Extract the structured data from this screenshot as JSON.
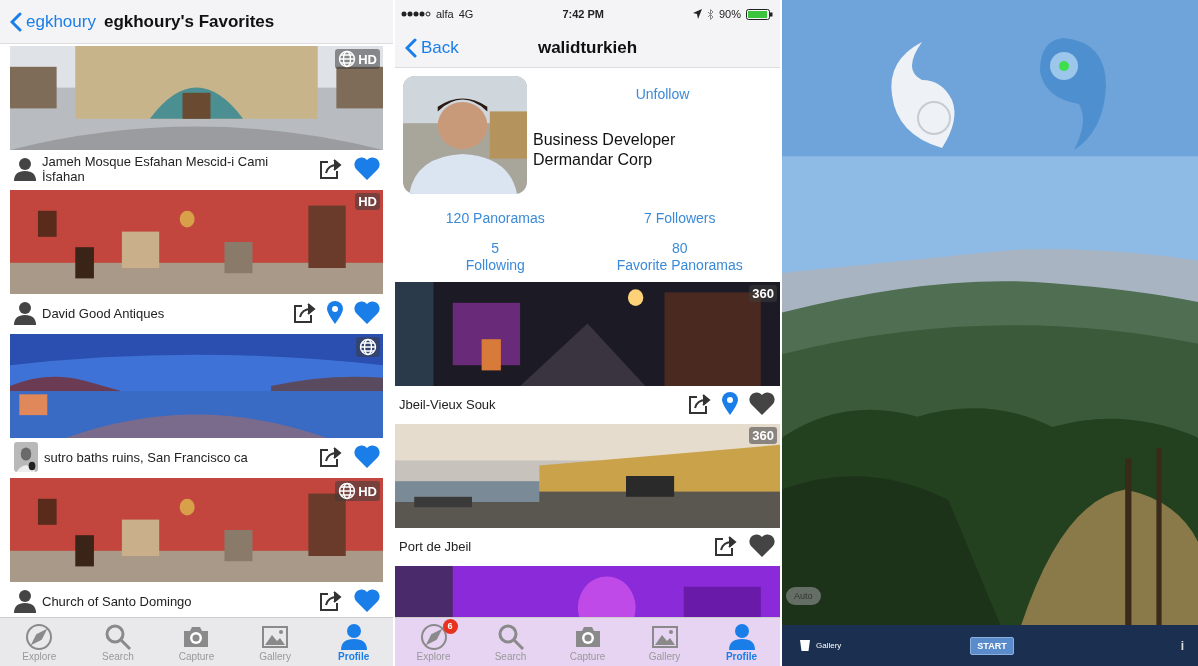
{
  "favorites_screen": {
    "back_label": "egkhoury",
    "title": "egkhoury's Favorites",
    "cards": [
      {
        "title": "Jameh Mosque Esfahan Mescid-i Cami İsfahan",
        "avatar": {
          "kind": "icon"
        },
        "badge": {
          "globe": true,
          "text": "HD"
        },
        "location": false,
        "favorited": true
      },
      {
        "title": "David Good Antiques",
        "avatar": {
          "kind": "icon"
        },
        "badge": {
          "globe": false,
          "text": "HD"
        },
        "location": true,
        "favorited": true
      },
      {
        "title": "sutro baths ruins, San Francisco ca",
        "avatar": {
          "kind": "picture"
        },
        "badge": {
          "globe": true
        },
        "location": false,
        "favorited": true
      },
      {
        "title": "Church of Santo Domingo",
        "avatar": {
          "kind": "icon"
        },
        "badge": {
          "globe": true,
          "text": "HD"
        },
        "location": false,
        "favorited": true
      }
    ],
    "tabs": [
      {
        "label": "Explore",
        "selected": false
      },
      {
        "label": "Search",
        "selected": false
      },
      {
        "label": "Capture",
        "selected": false
      },
      {
        "label": "Gallery",
        "selected": false
      },
      {
        "label": "Profile",
        "selected": true
      }
    ]
  },
  "profile_screen": {
    "status_bar": {
      "carrier": "alfa",
      "network": "4G",
      "time": "7:42 PM",
      "battery": "90%"
    },
    "back_label": "Back",
    "title": "walidturkieh",
    "follow_button": "Unfollow",
    "bio": [
      "Business Developer",
      "Dermandar Corp"
    ],
    "stats": [
      {
        "kind": "inline",
        "text": "120 Panoramas"
      },
      {
        "kind": "inline",
        "text": "7 Followers"
      },
      {
        "kind": "stacked",
        "count": "5",
        "label": "Following"
      },
      {
        "kind": "stacked",
        "count": "80",
        "label": "Favorite Panoramas"
      }
    ],
    "cards": [
      {
        "kind": "panorama",
        "title": "Jbeil-Vieux Souk",
        "badge": {
          "text": "360"
        },
        "location": true,
        "favorited": false
      },
      {
        "kind": "panorama",
        "title": "Port de Jbeil",
        "badge": {
          "text": "360"
        },
        "location": false,
        "favorited": false
      },
      {
        "kind": "picture"
      }
    ],
    "tabs": [
      {
        "label": "Explore",
        "selected": false,
        "badge": "6"
      },
      {
        "label": "Search",
        "selected": false
      },
      {
        "label": "Capture",
        "selected": false
      },
      {
        "label": "Gallery",
        "selected": false
      },
      {
        "label": "Profile",
        "selected": true
      }
    ]
  },
  "capture_screen": {
    "mode_pill": "Auto",
    "gallery_label": "Gallery",
    "start_button": "START",
    "info": "i"
  }
}
